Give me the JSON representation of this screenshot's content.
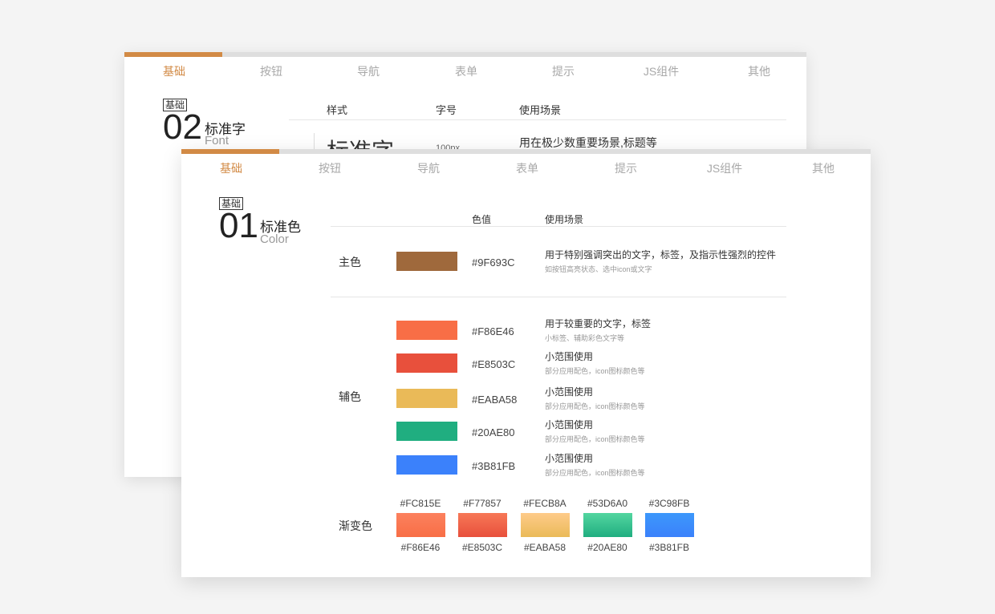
{
  "back_card": {
    "tabs": [
      "基础",
      "按钮",
      "导航",
      "表单",
      "提示",
      "JS组件",
      "其他"
    ],
    "active_tab": 0,
    "accent": "#d28a45",
    "section": {
      "badge": "基础",
      "number": "02",
      "title": "标准字",
      "subtitle": "Font"
    },
    "columns": {
      "style": "样式",
      "size": "字号",
      "usage": "使用场景"
    },
    "row": {
      "sample": "标准字",
      "size": "100px",
      "usage": "用在极少数重要场景,标题等"
    }
  },
  "front_card": {
    "tabs": [
      "基础",
      "按钮",
      "导航",
      "表单",
      "提示",
      "JS组件",
      "其他"
    ],
    "active_tab": 0,
    "accent": "#d28a45",
    "section": {
      "badge": "基础",
      "number": "01",
      "title": "标准色",
      "subtitle": "Color"
    },
    "columns": {
      "value": "色值",
      "usage": "使用场景"
    },
    "primary": {
      "label": "主色",
      "color": "#9F693C",
      "hex": "#9F693C",
      "usage": "用于特别强调突出的文字，标签，及指示性强烈的控件",
      "usage_sub": "如按钮高亮状态、选中icon或文字"
    },
    "secondary": {
      "label": "辅色",
      "items": [
        {
          "color": "#F86E46",
          "hex": "#F86E46",
          "usage": "用于较重要的文字，标签",
          "usage_sub": "小标签、辅助彩色文字等"
        },
        {
          "color": "#E8503C",
          "hex": "#E8503C",
          "usage": "小范围使用",
          "usage_sub": "部分应用配色，icon图标颜色等"
        },
        {
          "color": "#EABA58",
          "hex": "#EABA58",
          "usage": "小范围使用",
          "usage_sub": "部分应用配色，icon图标颜色等"
        },
        {
          "color": "#20AE80",
          "hex": "#20AE80",
          "usage": "小范围使用",
          "usage_sub": "部分应用配色，icon图标颜色等"
        },
        {
          "color": "#3B81FB",
          "hex": "#3B81FB",
          "usage": "小范围使用",
          "usage_sub": "部分应用配色，icon图标颜色等"
        }
      ]
    },
    "gradient": {
      "label": "渐变色",
      "items": [
        {
          "top": "#FC815E",
          "bottom": "#F86E46"
        },
        {
          "top": "#F77857",
          "bottom": "#E8503C"
        },
        {
          "top": "#FECB8A",
          "bottom": "#EABA58"
        },
        {
          "top": "#53D6A0",
          "bottom": "#20AE80"
        },
        {
          "top": "#3C98FB",
          "bottom": "#3B81FB"
        }
      ]
    }
  }
}
